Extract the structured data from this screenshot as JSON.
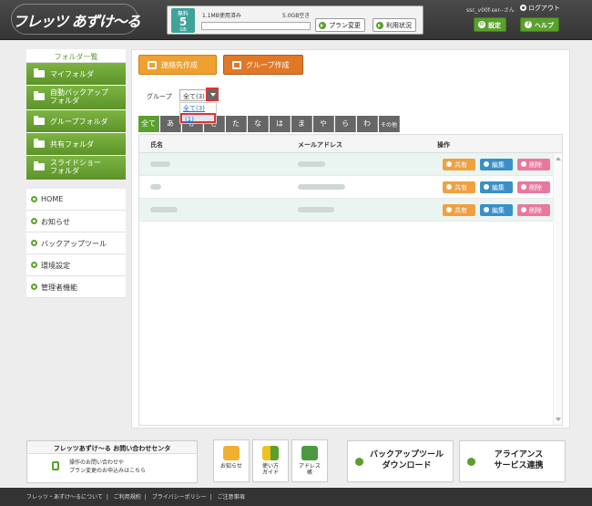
{
  "header": {
    "logo_text": "フレッツ あずけ〜る",
    "storage": {
      "badge_top": "無料",
      "badge_value": "5",
      "badge_unit": "GB",
      "used": "1.1MB使用済み",
      "free": "5.0GB空き",
      "used_fraction": 0.0002
    },
    "plan_change": "プラン変更",
    "usage_status": "利用状況",
    "user_name": "ssc_v00f-ser--さん",
    "logout": "ログアウト",
    "settings": "設定",
    "help": "ヘルプ"
  },
  "sidebar": {
    "title": "フォルダ一覧",
    "folders": [
      {
        "label": "マイフォルダ"
      },
      {
        "label": "自動バックアップ\nフォルダ"
      },
      {
        "label": "グループフォルダ"
      },
      {
        "label": "共有フォルダ"
      },
      {
        "label": "スライドショー\nフォルダ"
      }
    ],
    "links": [
      {
        "label": "HOME"
      },
      {
        "label": "お知らせ"
      },
      {
        "label": "バックアップツール"
      },
      {
        "label": "環境設定"
      },
      {
        "label": "管理者機能"
      }
    ]
  },
  "main": {
    "contact_button": "連絡先作成",
    "group_button": "グループ作成",
    "group_label": "グループ",
    "group_selected": "全て(3)",
    "dropdown_options": [
      "全て(3)",
      "(1)"
    ],
    "kana_tabs": [
      "全て",
      "あ",
      "か",
      "さ",
      "た",
      "な",
      "は",
      "ま",
      "や",
      "ら",
      "わ",
      "その他"
    ],
    "columns": {
      "name": "氏名",
      "email": "メールアドレス",
      "action": "操作"
    },
    "actions": {
      "share": "共有",
      "edit": "編集",
      "delete": "削除"
    },
    "row_count": 3
  },
  "footer": {
    "support_title": "フレッツあずけ〜る お問い合わせセンタ",
    "support_line1": "操作のお問い合わせや",
    "support_line2": "プラン変更のお申込みはこちら",
    "tiles": [
      {
        "label": "お知らせ"
      },
      {
        "label": "使い方\nガイド"
      },
      {
        "label": "アドレス\n帳"
      }
    ],
    "backup_tool": "バックアップツール\nダウンロード",
    "alliance": "アライアンス\nサービス連携",
    "links": [
      "フレッツ・あずけ〜るについて",
      "ご利用規約",
      "プライバシーポリシー",
      "ご注意事項"
    ]
  },
  "colors": {
    "green": "#5aa02c",
    "orange": "#f0a030",
    "dark_orange": "#e07828",
    "red_highlight": "#e23232",
    "blue": "#3a8fc8",
    "pink": "#e878a0"
  }
}
